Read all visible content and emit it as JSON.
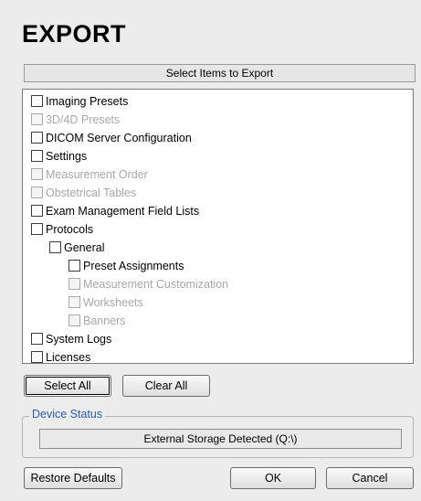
{
  "title": "EXPORT",
  "section_label": "Select Items to Export",
  "items": [
    {
      "label": "Imaging Presets",
      "enabled": true,
      "level": 0
    },
    {
      "label": "3D/4D Presets",
      "enabled": false,
      "level": 0
    },
    {
      "label": "DICOM Server Configuration",
      "enabled": true,
      "level": 0
    },
    {
      "label": "Settings",
      "enabled": true,
      "level": 0
    },
    {
      "label": "Measurement Order",
      "enabled": false,
      "level": 0
    },
    {
      "label": "Obstetrical Tables",
      "enabled": false,
      "level": 0
    },
    {
      "label": "Exam Management Field Lists",
      "enabled": true,
      "level": 0
    },
    {
      "label": "Protocols",
      "enabled": true,
      "level": 0
    },
    {
      "label": "General",
      "enabled": true,
      "level": 1
    },
    {
      "label": "Preset Assignments",
      "enabled": true,
      "level": 2
    },
    {
      "label": "Measurement Customization",
      "enabled": false,
      "level": 2
    },
    {
      "label": "Worksheets",
      "enabled": false,
      "level": 2
    },
    {
      "label": "Banners",
      "enabled": false,
      "level": 2
    },
    {
      "label": "System Logs",
      "enabled": true,
      "level": 0
    },
    {
      "label": "Licenses",
      "enabled": true,
      "level": 0
    }
  ],
  "buttons": {
    "select_all": "Select All",
    "clear_all": "Clear All",
    "restore_defaults": "Restore Defaults",
    "ok": "OK",
    "cancel": "Cancel"
  },
  "device_status": {
    "legend": "Device Status",
    "value": "External Storage Detected (Q:\\)"
  }
}
